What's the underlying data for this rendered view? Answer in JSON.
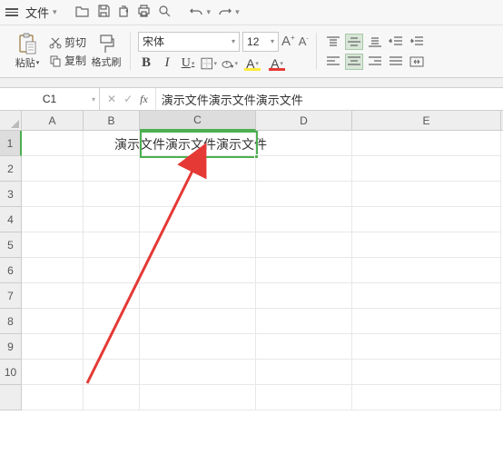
{
  "menu": {
    "file": "文件"
  },
  "clipboard": {
    "paste": "粘贴",
    "cut": "剪切",
    "copy": "复制",
    "brush": "格式刷"
  },
  "font": {
    "name": "宋体",
    "size": "12"
  },
  "nameBox": "C1",
  "formula": "演示文件演示文件演示文件",
  "cols": {
    "A": "A",
    "B": "B",
    "C": "C",
    "D": "D",
    "E": "E"
  },
  "rows": [
    "1",
    "2",
    "3",
    "4",
    "5",
    "6",
    "7",
    "8",
    "9",
    "10"
  ],
  "cellC1": "演示文件演示文件演示文件"
}
